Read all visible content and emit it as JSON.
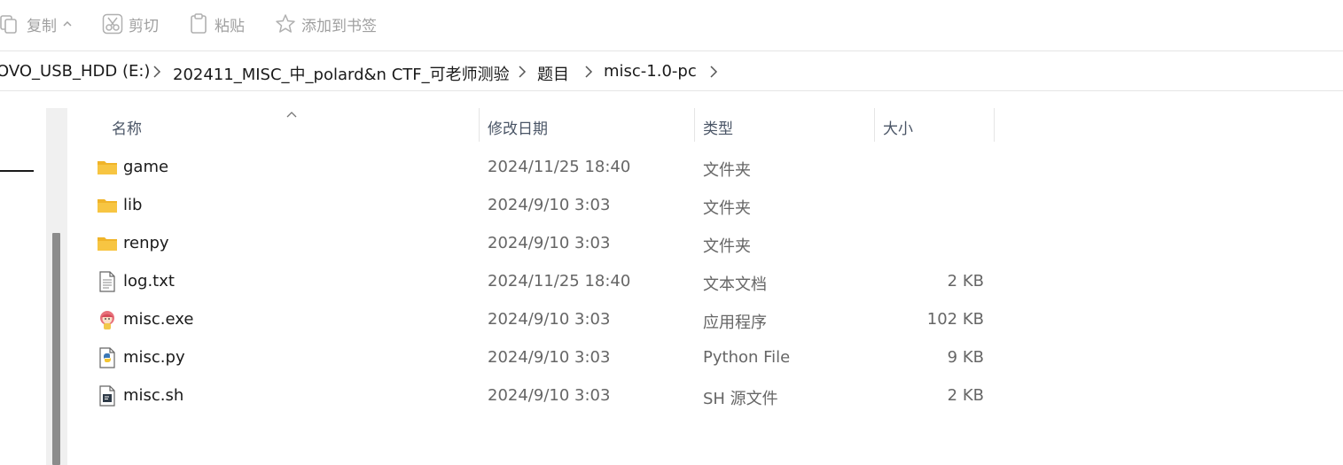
{
  "toolbar": {
    "copy_label": "复制",
    "cut_label": "剪切",
    "paste_label": "粘贴",
    "bookmark_label": "添加到书签"
  },
  "breadcrumb": {
    "items": [
      {
        "label": "OVO_USB_HDD (E:)"
      },
      {
        "label": "202411_MISC_中_polard&n CTF_可老师测验"
      },
      {
        "label": "题目"
      },
      {
        "label": "misc-1.0-pc"
      }
    ]
  },
  "columns": {
    "name": "名称",
    "modified": "修改日期",
    "type": "类型",
    "size": "大小"
  },
  "files": [
    {
      "name": "game",
      "modified": "2024/11/25 18:40",
      "type": "文件夹",
      "size": "",
      "icon": "folder-icon"
    },
    {
      "name": "lib",
      "modified": "2024/9/10 3:03",
      "type": "文件夹",
      "size": "",
      "icon": "folder-icon"
    },
    {
      "name": "renpy",
      "modified": "2024/9/10 3:03",
      "type": "文件夹",
      "size": "",
      "icon": "folder-icon"
    },
    {
      "name": "log.txt",
      "modified": "2024/11/25 18:40",
      "type": "文本文档",
      "size": "2 KB",
      "icon": "text-file-icon"
    },
    {
      "name": "misc.exe",
      "modified": "2024/9/10 3:03",
      "type": "应用程序",
      "size": "102 KB",
      "icon": "app-icon"
    },
    {
      "name": "misc.py",
      "modified": "2024/9/10 3:03",
      "type": "Python File",
      "size": "9 KB",
      "icon": "python-file-icon"
    },
    {
      "name": "misc.sh",
      "modified": "2024/9/10 3:03",
      "type": "SH 源文件",
      "size": "2 KB",
      "icon": "script-file-icon"
    }
  ],
  "colors": {
    "folder": "#f7c542",
    "disabled_text": "#a0a0a0",
    "header_text": "#4a5566"
  }
}
